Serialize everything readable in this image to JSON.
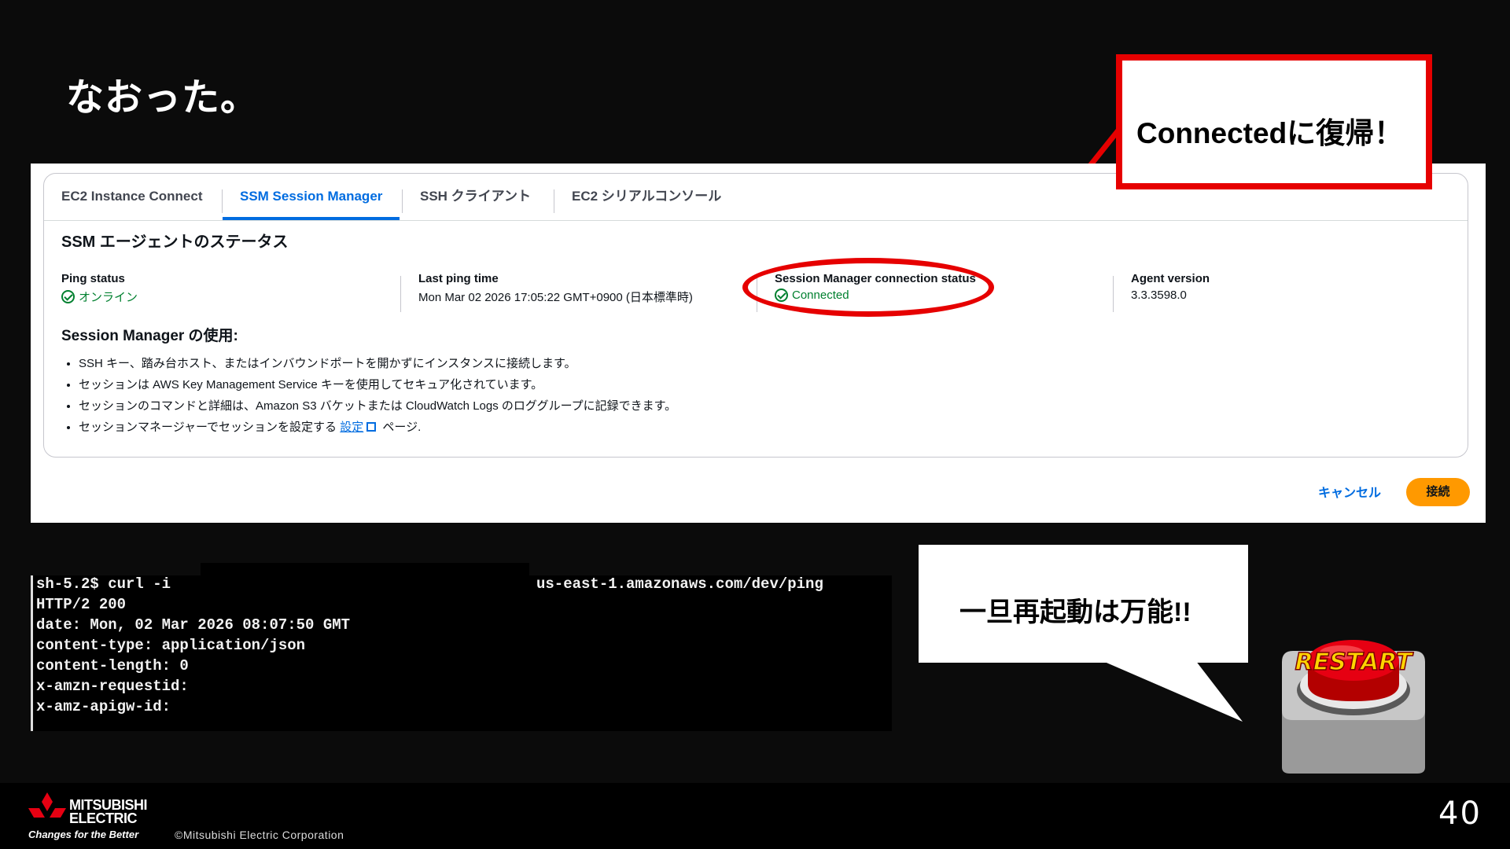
{
  "slide": {
    "title": "なおった。",
    "page_number": "40"
  },
  "tabs": [
    {
      "label": "EC2 Instance Connect",
      "active": false
    },
    {
      "label": "SSM Session Manager",
      "active": true
    },
    {
      "label": "SSH クライアント",
      "active": false
    },
    {
      "label": "EC2 シリアルコンソール",
      "active": false
    }
  ],
  "agent_status": {
    "title": "SSM エージェントのステータス",
    "ping_status": {
      "label": "Ping status",
      "value": "オンライン"
    },
    "last_ping": {
      "label": "Last ping time",
      "value": "Mon Mar 02 2026 17:05:22 GMT+0900 (日本標準時)"
    },
    "connection_status": {
      "label": "Session Manager connection status",
      "value": "Connected"
    },
    "agent_version": {
      "label": "Agent version",
      "value": "3.3.3598.0"
    }
  },
  "usage": {
    "title": "Session Manager の使用:",
    "items": [
      "SSH キー、踏み台ホスト、またはインバウンドポートを開かずにインスタンスに接続します。",
      "セッションは AWS Key Management Service キーを使用してセキュア化されています。",
      "セッションのコマンドと詳細は、Amazon S3 バケットまたは CloudWatch Logs のロググループに記録できます。"
    ],
    "last_item_prefix": "セッションマネージャーでセッションを設定する",
    "last_item_link": "設定",
    "last_item_suffix": "ページ."
  },
  "actions": {
    "cancel": "キャンセル",
    "connect": "接続"
  },
  "callout": {
    "text": "Connectedに復帰！",
    "color": "#e60000"
  },
  "terminal": {
    "lines": [
      "sh-5.2$ curl -i",
      "HTTP/2 200",
      "date: Mon, 02 Mar 2026 08:07:50 GMT",
      "content-type: application/json",
      "content-length: 0",
      "x-amzn-requestid:",
      "x-amz-apigw-id:"
    ],
    "url_tail": "us-east-1.amazonaws.com/dev/ping"
  },
  "speech_bubble": {
    "text": "一旦再起動は万能!!"
  },
  "restart_button": {
    "label": "RESTART"
  },
  "footer": {
    "brand_line1": "MITSUBISHI",
    "brand_line2": "ELECTRIC",
    "tagline": "Changes for the Better",
    "copyright": "©Mitsubishi Electric Corporation"
  },
  "colors": {
    "aws_blue": "#006ce0",
    "aws_orange": "#ff9900",
    "ok_green": "#00802f",
    "highlight_red": "#e60000"
  }
}
